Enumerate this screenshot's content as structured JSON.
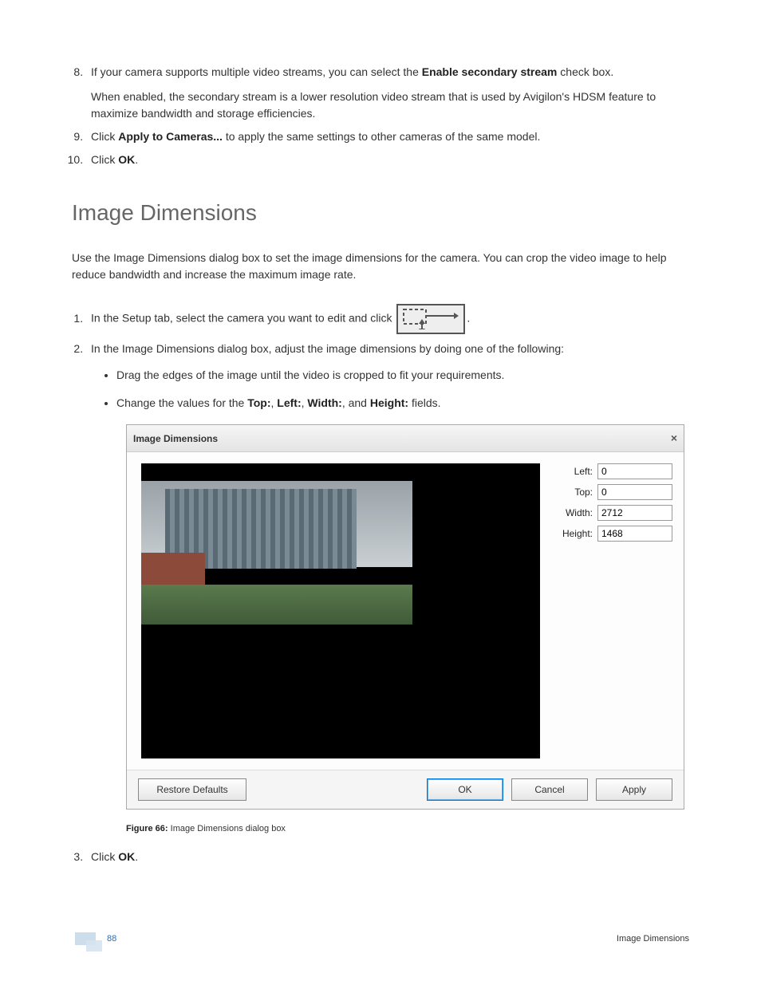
{
  "list_top": {
    "item8_a": "If your camera supports multiple video streams, you can select the ",
    "item8_b": "Enable secondary stream",
    "item8_c": " check box.",
    "item8_p2": "When enabled, the secondary stream is a lower resolution video stream that is used by Avigilon's HDSM feature to maximize bandwidth and storage efficiencies.",
    "item9_a": "Click ",
    "item9_b": "Apply to Cameras...",
    "item9_c": " to apply the same settings to other cameras of the same model.",
    "item10_a": "Click ",
    "item10_b": "OK",
    "item10_c": "."
  },
  "section_title": "Image Dimensions",
  "intro": "Use the Image Dimensions dialog box to set the image dimensions for the camera. You can crop the video image to help reduce bandwidth and increase the maximum image rate.",
  "list_mid": {
    "item1_a": "In the Setup tab, select the camera you want to edit and click ",
    "item1_c": ".",
    "item2": "In the Image Dimensions dialog box, adjust the image dimensions by doing one of the following:",
    "bullet1": "Drag the edges of the image until the video is cropped to fit your requirements.",
    "bullet2_a": "Change the values for the ",
    "bullet2_top": "Top:",
    "bullet2_s1": ", ",
    "bullet2_left": "Left:",
    "bullet2_s2": ", ",
    "bullet2_width": "Width:",
    "bullet2_s3": ", and ",
    "bullet2_height": "Height:",
    "bullet2_c": " fields."
  },
  "dialog": {
    "title": "Image Dimensions",
    "close": "×",
    "labels": {
      "left": "Left:",
      "top": "Top:",
      "width": "Width:",
      "height": "Height:"
    },
    "values": {
      "left": "0",
      "top": "0",
      "width": "2712",
      "height": "1468"
    },
    "buttons": {
      "restore": "Restore Defaults",
      "ok": "OK",
      "cancel": "Cancel",
      "apply": "Apply"
    }
  },
  "figure": {
    "label": "Figure 66:",
    "caption": " Image Dimensions dialog box"
  },
  "list_bottom": {
    "item3_a": "Click ",
    "item3_b": "OK",
    "item3_c": "."
  },
  "footer": {
    "page": "88",
    "title": "Image Dimensions"
  }
}
